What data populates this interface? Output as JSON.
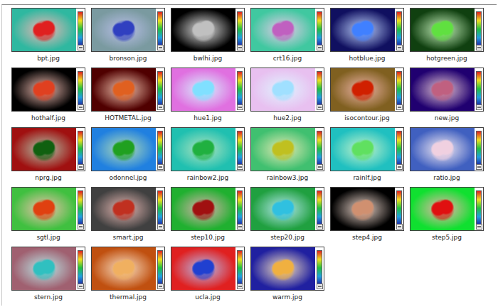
{
  "items": [
    {
      "name": "bpt.jpg",
      "color": "#2fb8a0",
      "accent": "#e02020"
    },
    {
      "name": "bronson.jpg",
      "color": "#7a9aa0",
      "accent": "#3040c0"
    },
    {
      "name": "bwlhi.jpg",
      "color": "#000000",
      "accent": "#c0c0c0"
    },
    {
      "name": "crt16.jpg",
      "color": "#40c8a0",
      "accent": "#c060c0"
    },
    {
      "name": "hotblue.jpg",
      "color": "#101060",
      "accent": "#4080ff"
    },
    {
      "name": "hotgreen.jpg",
      "color": "#104010",
      "accent": "#60e040"
    },
    {
      "name": "hothalf.jpg",
      "color": "#000000",
      "accent": "#e04020"
    },
    {
      "name": "HOTMETAL.jpg",
      "color": "#500000",
      "accent": "#e06020"
    },
    {
      "name": "hue1.jpg",
      "color": "#e070e0",
      "accent": "#80e0ff"
    },
    {
      "name": "hue2.jpg",
      "color": "#e8c0f0",
      "accent": "#a0e0ff"
    },
    {
      "name": "isocontour.jpg",
      "color": "#806020",
      "accent": "#d02000"
    },
    {
      "name": "new.jpg",
      "color": "#200070",
      "accent": "#c06080"
    },
    {
      "name": "nprg.jpg",
      "color": "#a01010",
      "accent": "#106010"
    },
    {
      "name": "odonnel.jpg",
      "color": "#2080e0",
      "accent": "#20a020"
    },
    {
      "name": "rainbow2.jpg",
      "color": "#20c0b0",
      "accent": "#20b040"
    },
    {
      "name": "rainbow3.jpg",
      "color": "#40c070",
      "accent": "#c0c020"
    },
    {
      "name": "rainlf.jpg",
      "color": "#20c0c0",
      "accent": "#60e060"
    },
    {
      "name": "ratio.jpg",
      "color": "#4060c0",
      "accent": "#f0d0e0"
    },
    {
      "name": "sgtl.jpg",
      "color": "#40c040",
      "accent": "#e04010"
    },
    {
      "name": "smart.jpg",
      "color": "#404040",
      "accent": "#c03020"
    },
    {
      "name": "step10.jpg",
      "color": "#20b030",
      "accent": "#a01010"
    },
    {
      "name": "step20.jpg",
      "color": "#20a040",
      "accent": "#30c0e0"
    },
    {
      "name": "step4.jpg",
      "color": "#000000",
      "accent": "#d09070"
    },
    {
      "name": "step5.jpg",
      "color": "#10e030",
      "accent": "#e01010"
    },
    {
      "name": "stern.jpg",
      "color": "#a06070",
      "accent": "#30c0c0"
    },
    {
      "name": "thermal.jpg",
      "color": "#c05010",
      "accent": "#f0b060"
    },
    {
      "name": "ucla.jpg",
      "color": "#e02020",
      "accent": "#2040d0"
    },
    {
      "name": "warm.jpg",
      "color": "#2020a0",
      "accent": "#f0b040"
    }
  ]
}
